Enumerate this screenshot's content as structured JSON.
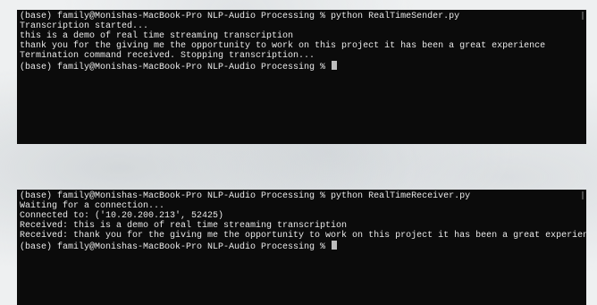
{
  "sender_terminal": {
    "lines": [
      "(base) family@Monishas-MacBook-Pro NLP-Audio Processing % python RealTimeSender.py",
      "Transcription started...",
      "this is a demo of real time streaming transcription",
      "thank you for the giving me the opportunity to work on this project it has been a great experience",
      "Termination command received. Stopping transcription...",
      "(base) family@Monishas-MacBook-Pro NLP-Audio Processing % "
    ]
  },
  "receiver_terminal": {
    "lines": [
      "(base) family@Monishas-MacBook-Pro NLP-Audio Processing % python RealTimeReceiver.py",
      "Waiting for a connection...",
      "Connected to: ('10.20.200.213', 52425)",
      "Received: this is a demo of real time streaming transcription",
      "Received: thank you for the giving me the opportunity to work on this project it has been a great experience",
      "(base) family@Monishas-MacBook-Pro NLP-Audio Processing % "
    ]
  },
  "colors": {
    "terminal_background": "#0b0b0b",
    "terminal_text": "#e9e9e9",
    "page_background": "#eef0f1"
  }
}
